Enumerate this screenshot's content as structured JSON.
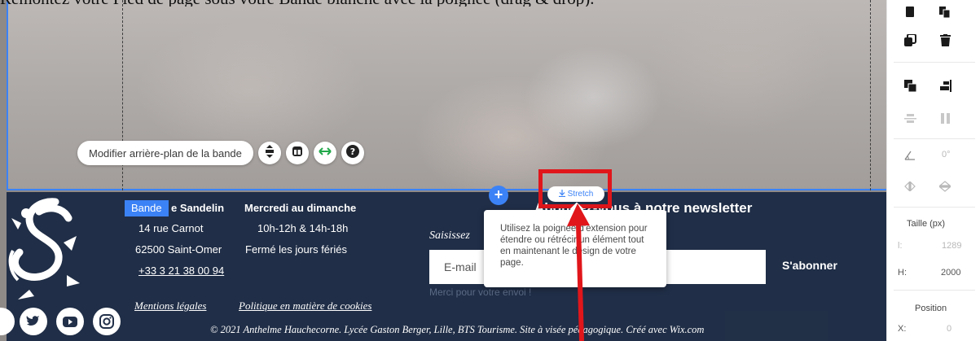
{
  "caption": "Remontez votre Pied de page sous votre Bande blanche avec la poignée (drag & drop).",
  "bande_toolbar": {
    "background_button_label": "Modifier arrière-plan de la bande",
    "icons": [
      "layers-icon",
      "layout-icon",
      "stretch-arrows-icon",
      "help-icon"
    ]
  },
  "bande_tag": "Bande",
  "stretch_button_label": "Stretch",
  "tooltip_text": "Utilisez la poignée d'extension pour étendre ou rétrécir un élément tout en maintenant le design de votre page.",
  "footer": {
    "address": {
      "name_fragment": "e Sandelin",
      "street": "14 rue Carnot",
      "city": "62500 Saint-Omer",
      "phone": "+33 3 21 38 00 94"
    },
    "hours": {
      "title": "Mercredi au dimanche",
      "times": "10h-12h & 14h-18h",
      "closed": "Fermé les jours fériés"
    },
    "newsletter_title": "Abonnez-vous à notre newsletter",
    "input_label_fragment": "Saisissez",
    "email_placeholder": "E-mail",
    "subscribe_label": "S'abonner",
    "thanks_message": "Merci pour votre envoi !",
    "legal_link": "Mentions légales",
    "cookies_link": "Politique en matière de cookies",
    "copyright": "© 2021 Anthelme Hauchecorne. Lycée Gaston Berger, Lille, BTS Tourisme. Site à visée pédagogique. Créé avec Wix.com",
    "social_icons": [
      "social-partial-icon",
      "twitter-icon",
      "youtube-icon",
      "instagram-icon"
    ]
  },
  "panel": {
    "rotation_value": "0°",
    "size_label": "Taille (px)",
    "width_label": "l:",
    "width_value": "1289",
    "height_label": "H:",
    "height_value": "2000",
    "position_label": "Position",
    "x_label": "X:",
    "x_value": "0"
  },
  "colors": {
    "accent_blue": "#3b82f6",
    "highlight_red": "#e0161b",
    "footer_navy": "#223049"
  }
}
